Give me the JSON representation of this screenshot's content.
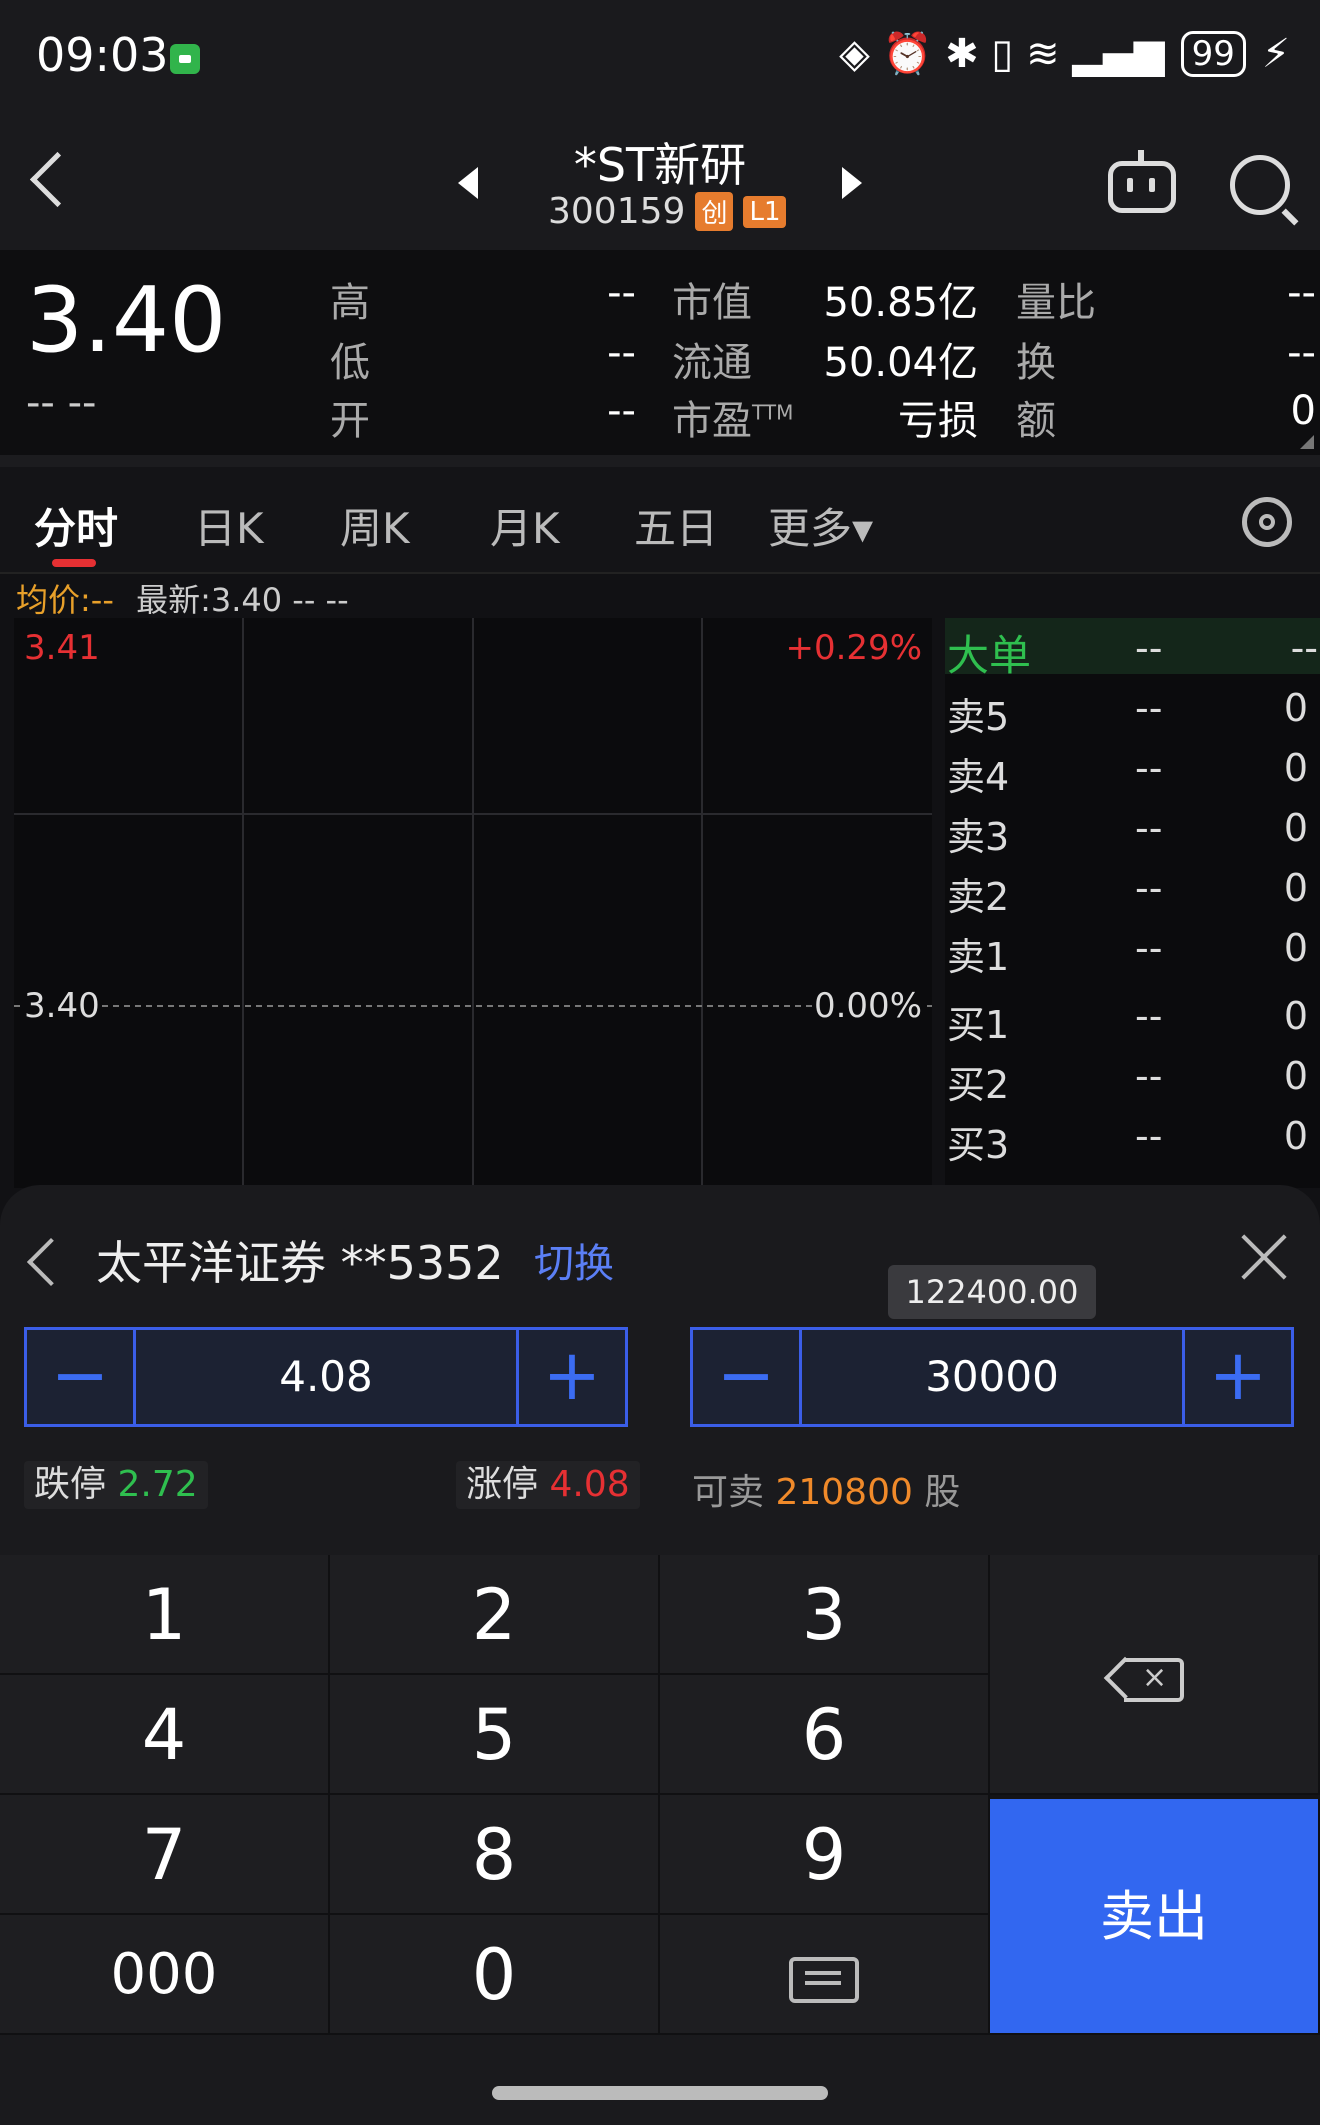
{
  "status": {
    "time": "09:03",
    "battery": "99",
    "icons_text": "◈ ⏰ ✱ ▯ ≋ ▂▄▆"
  },
  "header": {
    "name": "*ST新研",
    "code": "300159",
    "tag1": "创",
    "tag2": "L1"
  },
  "quote": {
    "price": "3.40",
    "change": "--  --",
    "rows": [
      {
        "l1": "高",
        "v1": "--",
        "l2": "市值",
        "v2": "50.85亿",
        "l3": "量比",
        "v3": "--"
      },
      {
        "l1": "低",
        "v1": "--",
        "l2": "流通",
        "v2": "50.04亿",
        "l3": "换",
        "v3": "--"
      },
      {
        "l1": "开",
        "v1": "--",
        "l2": "市盈",
        "l2_sup": "TTM",
        "v2": "亏损",
        "l3": "额",
        "v3": "0"
      }
    ]
  },
  "tabs": [
    "分时",
    "日K",
    "周K",
    "月K",
    "五日",
    "更多▾"
  ],
  "chart": {
    "avg_label": "均价:--",
    "latest_label": "最新:3.40  --  --",
    "top_price": "3.41",
    "top_pct": "+0.29%",
    "mid_price": "3.40",
    "mid_pct": "0.00%"
  },
  "orderbook": {
    "head": {
      "label": "大单",
      "price": "--",
      "vol": "--"
    },
    "rows": [
      {
        "label": "卖5",
        "price": "--",
        "vol": "0"
      },
      {
        "label": "卖4",
        "price": "--",
        "vol": "0"
      },
      {
        "label": "卖3",
        "price": "--",
        "vol": "0"
      },
      {
        "label": "卖2",
        "price": "--",
        "vol": "0"
      },
      {
        "label": "卖1",
        "price": "--",
        "vol": "0"
      },
      {
        "label": "买1",
        "price": "--",
        "vol": "0"
      },
      {
        "label": "买2",
        "price": "--",
        "vol": "0"
      },
      {
        "label": "买3",
        "price": "--",
        "vol": "0"
      }
    ]
  },
  "trade": {
    "account": "太平洋证券 **5352",
    "switch": "切换",
    "tooltip": "122400.00",
    "price_value": "4.08",
    "qty_value": "30000",
    "limit_down_label": "跌停",
    "limit_down": "2.72",
    "limit_up_label": "涨停",
    "limit_up": "4.08",
    "sellable_label": "可卖",
    "sellable_num": "210800",
    "sellable_unit": "股"
  },
  "keypad": {
    "k1": "1",
    "k2": "2",
    "k3": "3",
    "k4": "4",
    "k5": "5",
    "k6": "6",
    "k7": "7",
    "k8": "8",
    "k9": "9",
    "k000": "000",
    "k0": "0",
    "sell": "卖出"
  },
  "colors": {
    "red": "#e63033",
    "green": "#2fbf4f",
    "blue": "#3267f0",
    "orange": "#f08a2a"
  }
}
